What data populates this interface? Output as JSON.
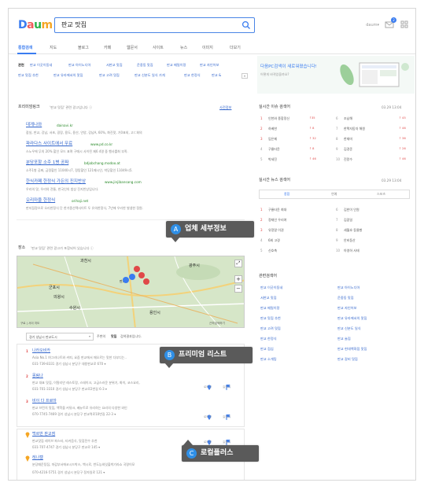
{
  "logo": [
    "D",
    "a",
    "u",
    "m"
  ],
  "search": {
    "query": "판교 맛집"
  },
  "header": {
    "user": "daum▾",
    "mail_badge": "2"
  },
  "tabs": [
    "통합검색",
    "지도",
    "블로그",
    "카페",
    "웹문서",
    "사이트",
    "뉴스",
    "이미지",
    "더보기"
  ],
  "related": {
    "label": "관련",
    "row1": [
      "판교 이곳이동네",
      "판교 아이노디아",
      "서판교 맛집",
      "운중동 맛집",
      "판교 메밀이랑",
      "판교 자인어보"
    ],
    "row2": [
      "판교 맛집 추천",
      "판교 유라에서의 맛집",
      "판교 고려 맛집",
      "판교 신분도 일식 가게",
      "판교 한정식",
      "판교 &"
    ],
    "banner_title": "다음PC검색이 새로워졌습니다!",
    "banner_sub": "어떻게 바뀌었을까요?"
  },
  "premium_links": {
    "title": "프리미엄링크",
    "sub": "'판교 맛집' 관련 광고입니다 ⓘ",
    "register": "사전정보",
    "items": [
      {
        "title": "데게나와",
        "url": "dainavi.kr",
        "desc": "잠실, 판교, 강남, 서초, 광장, 용도, 용산, 안양, 강남A, 60%, 화진맛, 기0표외, 고ㄷ회의"
      },
      {
        "title": "파라다스 사이트에서 무료",
        "url": "www.pd.co.kr",
        "desc": "스노우에 무의 20% 할인 모드 표며 구매시 사이된 제6 4명 중 행사를최 부족."
      },
      {
        "title": "분당포항 소주 1병 공짜",
        "url": "bdjobchang.modoo.at",
        "desc": "소주1병 공짜, 금정할인 11040시7, 정탕할인 121메시인, 박당할인 11049시5."
      },
      {
        "title": "한식카페 한정식 가든의 진지반상",
        "url": "www.jinjibansang.com",
        "desc": "우리의 맛, 우리의 전통, 한국인의 밥상 진지반상입니다."
      },
      {
        "title": "오리마을 한정식",
        "url": "orihaji.net",
        "desc": "판지점정으로 오리한정식 단 한가종선택사이트 두 유의한정식, 7년에 우리한 발생한 정원."
      }
    ]
  },
  "place": {
    "title": "장소",
    "sub": "'판교 맛집' 관련 광고가 포함되어 있습니다 ⓘ",
    "region": "경기 성남시 판교도시",
    "near": "주변의",
    "keyword": "맛집",
    "near_suffix": "검색결과입니다.",
    "map_labels": [
      "과천시",
      "광주시",
      "군포시",
      "의왕시",
      "수원시",
      "용인시",
      "판교"
    ],
    "map_footer": "구로 | 사이 지도",
    "map_footer_right": "근처검색하기"
  },
  "listings": [
    {
      "n": "1",
      "title": "나라오비카",
      "desc": "Asia No.1 여그러나트와 커피, 요즘 판교에서 매오르는 맛한 다부디는..",
      "phone": "031-739-8331 경기 성남시 분당구 대왕판교로 670 ▾"
    },
    {
      "n": "2",
      "title": "몽림나",
      "desc": "판교 대표 맛집, 이탈리안 레스토랑, 스테이크, 고급스러운 분위기, 화이, 코스요리,",
      "phone": "031-701-3310 경기 성남시 분당구 판교로2번길 6-3 ▾"
    },
    {
      "n": "3",
      "title": "비이 다 프로마",
      "desc": "판교 브런치 맛집, 백학을 커뮤크, 베뉴트로 유리하는 요리의 다양한 와인",
      "phone": "070-7745-7469 경기 성남시 분당구 판교역로10번길 22-3 ▾"
    }
  ],
  "local": [
    {
      "title": "백르반 판교점",
      "desc": "판교맛집 레이브 파스타, 티커음식, 맛집전수 추천",
      "phone": "031-707-4747 경기 성남시 분당구 판교로 145 ▾"
    },
    {
      "title": "레나캘",
      "desc": "분당매운탕집, 마감부서에코시드박스, 백시로, 번도능외잇출박기라쇼 곡명이모",
      "phone": "070-4216-5751 경기 성남시 분당구 정자일로 121 ▾"
    }
  ],
  "actions": {
    "route": "로드뷰",
    "directions": "길찾기"
  },
  "trending": {
    "title": "실시간 이슈 검색어",
    "time": "03.29  13:04",
    "left": [
      {
        "n": "1",
        "t": "인천와 종합정신",
        "d": "↑35"
      },
      {
        "n": "2",
        "t": "하베한",
        "d": "↑ 8"
      },
      {
        "n": "3",
        "t": "임은제",
        "d": "↑ 32"
      },
      {
        "n": "4",
        "t": "구룡타윤",
        "d": "↑ 8"
      },
      {
        "n": "5",
        "t": "박세진",
        "d": "↑ 46"
      }
    ],
    "right": [
      {
        "n": "6",
        "t": "조남해",
        "d": "↑ 45"
      },
      {
        "n": "7",
        "t": "한택자동차 해원",
        "d": "↑ 46"
      },
      {
        "n": "8",
        "t": "한재미",
        "d": "↑ 36"
      },
      {
        "n": "9",
        "t": "김경준",
        "d": "↑ 26"
      },
      {
        "n": "10",
        "t": "진랑수",
        "d": "↑ 46"
      }
    ]
  },
  "news_trending": {
    "title": "실시간 뉴스 검색어",
    "time": "03.29  13:04",
    "tabs": [
      "종합",
      "연예",
      "스포츠"
    ],
    "left": [
      {
        "n": "1",
        "t": "구룡타윤 최대"
      },
      {
        "n": "2",
        "t": "정재인 우리여"
      },
      {
        "n": "3",
        "t": "유정말 이권"
      },
      {
        "n": "4",
        "t": "6회 고경"
      },
      {
        "n": "5",
        "t": "신호축"
      }
    ],
    "right": [
      {
        "n": "6",
        "t": "김한이 인원"
      },
      {
        "n": "7",
        "t": "김광일"
      },
      {
        "n": "8",
        "t": "세월호 동물빵"
      },
      {
        "n": "9",
        "t": "안비동산"
      },
      {
        "n": "10",
        "t": "아영하 사태"
      }
    ]
  },
  "related_keywords": {
    "title": "관련검색어",
    "left": [
      "판교 이곳이동네",
      "서판교 맛집",
      "판교 메밀이랑",
      "판교 맛집 추천",
      "판교 고려 맛집",
      "판교 한정식",
      "판교 점심",
      "판교 소개팅"
    ],
    "right": [
      "판교 아이노디아",
      "운중동 맛집",
      "판교 자인어보",
      "판교 유라에서의 맛집",
      "판교 신분도 일식",
      "판교 술집",
      "판교 현대백화점 맛집",
      "판교 갈비 맛집"
    ]
  },
  "callouts": [
    {
      "c": "A",
      "label": "업체 세부정보"
    },
    {
      "c": "B",
      "label": "프리미엄 리스트"
    },
    {
      "c": "C",
      "label": "로컬플러스"
    }
  ],
  "colors": {
    "accent": "#3a7cf0",
    "callout_bg": "#5a5a5a",
    "callout_circle": "#2f8fe6",
    "rank_red": "#e04848"
  }
}
